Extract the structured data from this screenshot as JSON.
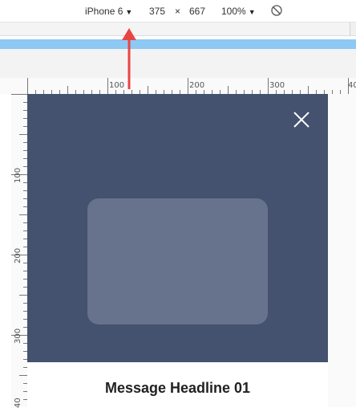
{
  "device_toolbar": {
    "device": "iPhone 6",
    "width": "375",
    "times": "×",
    "height": "667",
    "zoom": "100%"
  },
  "ruler": {
    "horizontal_labels": [
      "100",
      "200",
      "300",
      "40"
    ],
    "vertical_labels": [
      "100",
      "200",
      "300",
      "40"
    ]
  },
  "modal": {
    "headline": "Message Headline 01",
    "hero_color": "#44516f",
    "placeholder_color": "#67728d"
  },
  "colors": {
    "breakpoint_bar": "#8ec9f3",
    "arrow": "#e94444"
  },
  "icons": {
    "close": "close-icon",
    "rotate": "rotate-icon",
    "dropdown": "triangle-down-icon",
    "arrow": "arrow-up-icon"
  }
}
